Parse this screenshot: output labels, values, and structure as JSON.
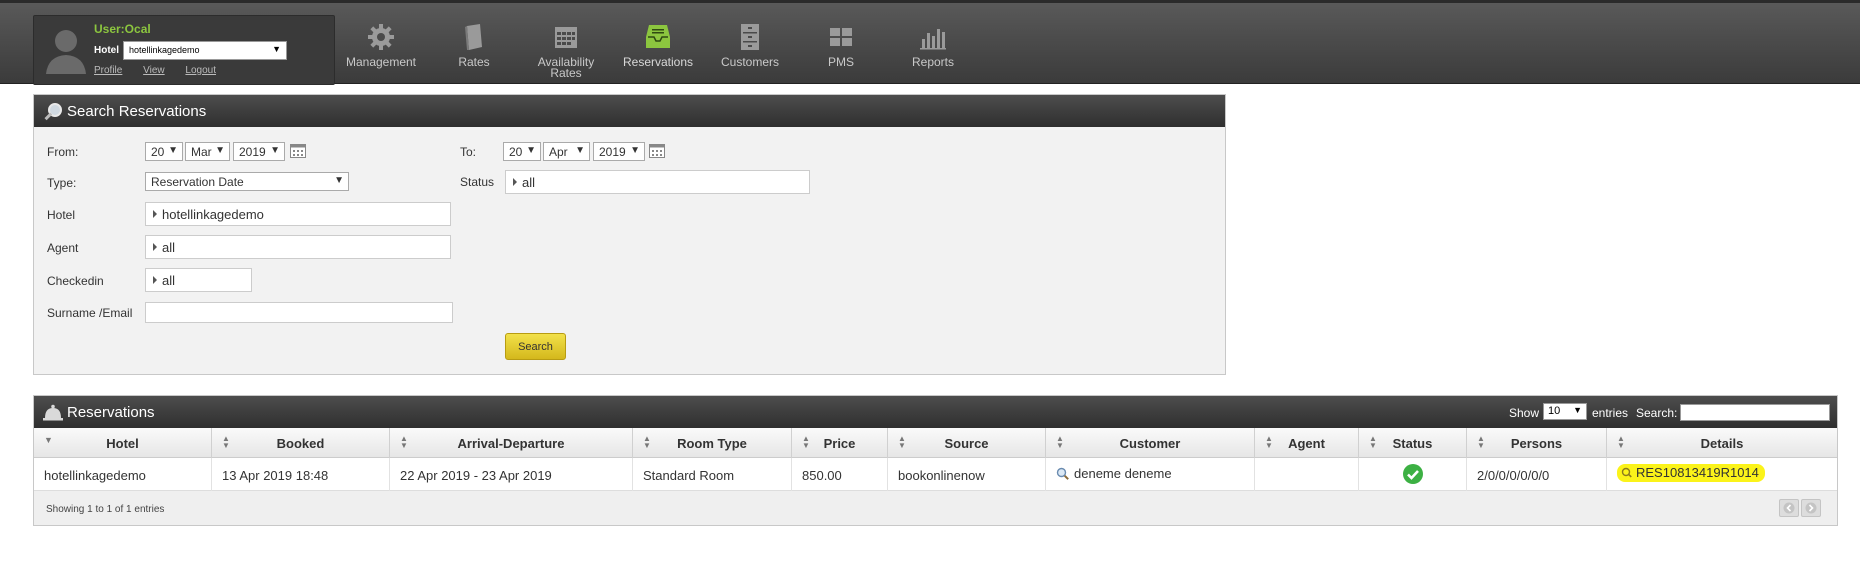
{
  "header": {
    "user_label": "User:Ocal",
    "hotel_label": "Hotel",
    "hotel_value": "hotellinkagedemo",
    "links": [
      "Profile",
      "View",
      "Logout"
    ],
    "nav": [
      {
        "label": "Management",
        "icon": "gear-icon"
      },
      {
        "label": "Rates",
        "icon": "book-icon"
      },
      {
        "label": "Availability Rates",
        "icon": "calendar-icon"
      },
      {
        "label": "Reservations",
        "icon": "inbox-icon"
      },
      {
        "label": "Customers",
        "icon": "cabinet-icon"
      },
      {
        "label": "PMS",
        "icon": "grid-icon"
      },
      {
        "label": "Reports",
        "icon": "bar-chart-icon"
      }
    ],
    "active_nav": "Reservations"
  },
  "search": {
    "title": "Search Reservations",
    "from_label": "From:",
    "from_day": "20",
    "from_month": "Mar",
    "from_year": "2019",
    "to_label": "To:",
    "to_day": "20",
    "to_month": "Apr",
    "to_year": "2019",
    "type_label": "Type:",
    "type_value": "Reservation Date",
    "status_label": "Status",
    "status_value": "all",
    "hotel_label": "Hotel",
    "hotel_value": "hotellinkagedemo",
    "agent_label": "Agent",
    "agent_value": "all",
    "checkedin_label": "Checkedin",
    "checkedin_value": "all",
    "surname_label": "Surname /Email",
    "surname_value": "",
    "button_label": "Search"
  },
  "reservations": {
    "title": "Reservations",
    "show_label": "Show",
    "show_value": "10",
    "entries_label": "entries",
    "search_label": "Search:",
    "columns": [
      "Hotel",
      "Booked",
      "Arrival-Departure",
      "Room Type",
      "Price",
      "Source",
      "Customer",
      "Agent",
      "Status",
      "Persons",
      "Details"
    ],
    "rows": [
      {
        "hotel": "hotellinkagedemo",
        "booked": "13 Apr 2019 18:48",
        "arrival_departure": "22 Apr 2019 - 23 Apr 2019",
        "room_type": "Standard Room",
        "price": "850.00",
        "source": "bookonlinenow",
        "customer": "deneme deneme",
        "agent": "",
        "status": "confirmed",
        "persons": "2/0/0/0/0/0/0",
        "details": "RES10813419R1014"
      }
    ],
    "footer_info": "Showing 1 to 1 of 1 entries"
  },
  "colors": {
    "accent_green": "#8cc63f",
    "highlight_yellow": "#fbf31a",
    "button_yellow": "#e3c92f"
  }
}
